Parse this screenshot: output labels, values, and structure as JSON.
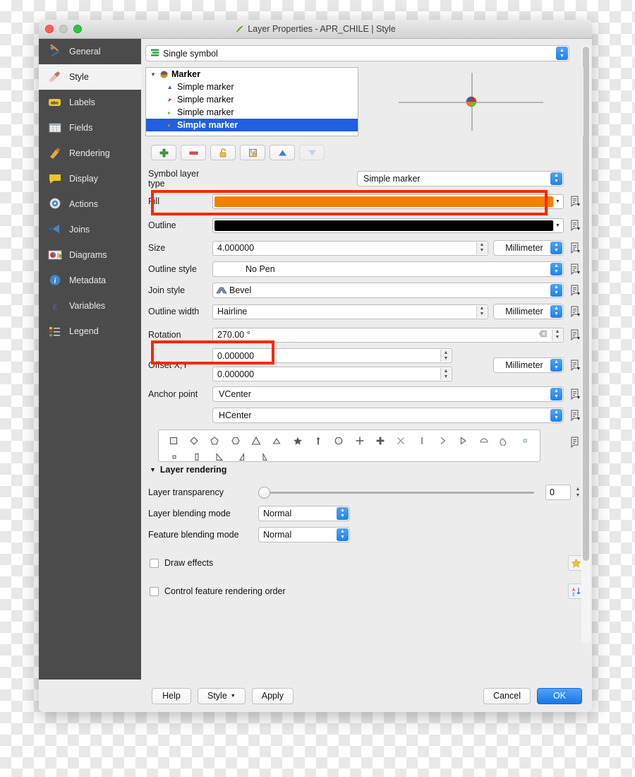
{
  "window": {
    "title": "Layer Properties - APR_CHILE | Style",
    "traffic_lights": [
      "close",
      "minimize",
      "maximize"
    ]
  },
  "sidebar": {
    "items": [
      {
        "label": "General",
        "icon": "tools-icon",
        "active": false
      },
      {
        "label": "Style",
        "icon": "brush-icon",
        "active": true
      },
      {
        "label": "Labels",
        "icon": "abc-label-icon",
        "active": false
      },
      {
        "label": "Fields",
        "icon": "table-icon",
        "active": false
      },
      {
        "label": "Rendering",
        "icon": "broom-icon",
        "active": false
      },
      {
        "label": "Display",
        "icon": "speech-bubble-icon",
        "active": false
      },
      {
        "label": "Actions",
        "icon": "gear-play-icon",
        "active": false
      },
      {
        "label": "Joins",
        "icon": "join-arrow-icon",
        "active": false
      },
      {
        "label": "Diagrams",
        "icon": "chart-image-icon",
        "active": false
      },
      {
        "label": "Metadata",
        "icon": "info-icon",
        "active": false
      },
      {
        "label": "Variables",
        "icon": "epsilon-icon",
        "active": false
      },
      {
        "label": "Legend",
        "icon": "legend-list-icon",
        "active": false
      }
    ]
  },
  "renderer": {
    "value": "Single symbol",
    "icon": "single-symbol-icon"
  },
  "symbol_tree": {
    "root": {
      "label": "Marker",
      "icon": "pie-marker-icon",
      "expanded": true
    },
    "children": [
      {
        "label": "Simple marker",
        "color": "#3b5fa8",
        "selected": false
      },
      {
        "label": "Simple marker",
        "color": "#e02020",
        "selected": false
      },
      {
        "label": "Simple marker",
        "color": "#5ec13a",
        "selected": false
      },
      {
        "label": "Simple marker",
        "color": "#f07818",
        "selected": true
      }
    ]
  },
  "preview": {
    "name": "symbol-preview",
    "quadrants": [
      "#3b5fa8",
      "#e02020",
      "#f07818",
      "#5ec13a"
    ]
  },
  "symbol_toolbar": [
    {
      "name": "add-symbol-layer-button",
      "icon": "plus-icon",
      "enabled": true
    },
    {
      "name": "remove-symbol-layer-button",
      "icon": "minus-icon",
      "enabled": true
    },
    {
      "name": "lock-layer-button",
      "icon": "lock-open-icon",
      "enabled": true
    },
    {
      "name": "duplicate-layer-button",
      "icon": "copy-icon",
      "enabled": true
    },
    {
      "name": "move-up-button",
      "icon": "triangle-up-icon",
      "enabled": true
    },
    {
      "name": "move-down-button",
      "icon": "triangle-down-icon",
      "enabled": false
    }
  ],
  "form": {
    "symbol_layer_type": {
      "label": "Symbol layer type",
      "value": "Simple marker"
    },
    "fill": {
      "label": "Fill",
      "color": "#f77f00",
      "highlighted": true
    },
    "outline": {
      "label": "Outline",
      "color": "#000000",
      "highlighted": false
    },
    "size": {
      "label": "Size",
      "value": "4.000000",
      "unit": "Millimeter"
    },
    "outline_style": {
      "label": "Outline style",
      "value": "No Pen"
    },
    "join_style": {
      "label": "Join style",
      "value": "Bevel",
      "icon": "bevel-join-icon"
    },
    "outline_width": {
      "label": "Outline width",
      "value": "Hairline",
      "unit": "Millimeter"
    },
    "rotation": {
      "label": "Rotation",
      "value": "270.00 °",
      "highlighted": true,
      "clear_icon": "clear-icon"
    },
    "offset_xy": {
      "label": "Offset X,Y",
      "value_x": "0.000000",
      "value_y": "0.000000",
      "unit": "Millimeter"
    },
    "anchor_point": {
      "label": "Anchor point",
      "value_v": "VCenter",
      "value_h": "HCenter"
    }
  },
  "shape_palette": {
    "row1": [
      "square",
      "diamond",
      "pentagon",
      "hexagon",
      "triangle",
      "equilateral-triangle",
      "star",
      "arrow",
      "circle",
      "cross",
      "cross-fill",
      "x-cross",
      "line",
      "right-half-triangle",
      "right-triangle",
      "half-circle",
      "quarter-circle",
      "quarter-square"
    ],
    "row2": [
      "small-square",
      "thin-rectangle",
      "right-angle-triangle",
      "diagonal-half",
      "left-angle-triangle"
    ]
  },
  "layer_rendering": {
    "title": "Layer rendering",
    "expanded": true,
    "transparency": {
      "label": "Layer transparency",
      "value": "0",
      "min": 0,
      "max": 100
    },
    "layer_blending": {
      "label": "Layer blending mode",
      "value": "Normal"
    },
    "feature_blending": {
      "label": "Feature blending mode",
      "value": "Normal"
    },
    "draw_effects": {
      "label": "Draw effects",
      "checked": false,
      "icon": "star-icon"
    },
    "control_order": {
      "label": "Control feature rendering order",
      "checked": false,
      "icon": "sort-az-icon"
    }
  },
  "footer": {
    "help": "Help",
    "style": "Style",
    "apply": "Apply",
    "cancel": "Cancel",
    "ok": "OK"
  },
  "colors": {
    "accent_blue": "#1877e8",
    "selection_blue": "#1f5fe0",
    "annotation_red": "#fa2800",
    "fill_orange": "#f77f00",
    "sidebar_bg": "#4b4b4b"
  }
}
